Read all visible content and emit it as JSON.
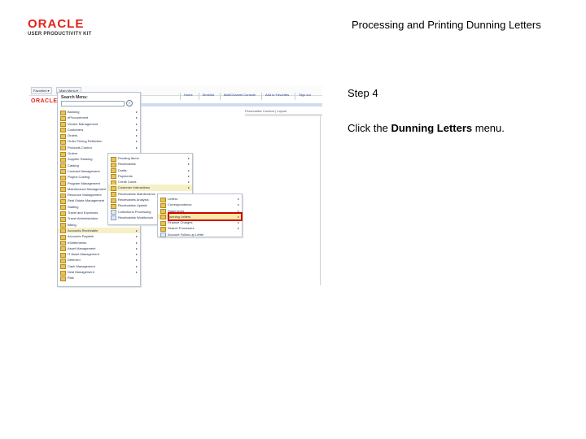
{
  "logo": {
    "word": "ORACLE",
    "sub": "USER PRODUCTIVITY KIT"
  },
  "doc": {
    "title": "Processing and Printing Dunning Letters",
    "step": "Step 4",
    "instruction_pre": "Click the ",
    "instruction_bold": "Dunning Letters",
    "instruction_post": " menu."
  },
  "screenshot": {
    "favorites": "Favorites ▾",
    "main_menu": "Main Menu ▾",
    "top_links": [
      "Home",
      "Worklist",
      "MultiChannel Console",
      "Add to Favorites",
      "Sign out"
    ],
    "mini_logo": "ORACLE",
    "personalize": "Personalize Content | Layout",
    "search_label": "Search Menu:",
    "search_go": "»",
    "menu1": [
      {
        "label": "Banking",
        "arrow": "▸"
      },
      {
        "label": "eProcurement",
        "arrow": "▸"
      },
      {
        "label": "Vendor Management",
        "arrow": "▸"
      },
      {
        "label": "Customers",
        "arrow": "▸"
      },
      {
        "label": "Orders",
        "arrow": "▸"
      },
      {
        "label": "Order Pricing Reflection",
        "arrow": "▸"
      },
      {
        "label": "Products Control",
        "arrow": "▸"
      },
      {
        "label": "Orders",
        "arrow": "▸"
      },
      {
        "label": "Supplier Ranking",
        "arrow": "▸"
      },
      {
        "label": "Catalog",
        "arrow": "▸"
      },
      {
        "label": "Contract Management",
        "arrow": "▸"
      },
      {
        "label": "Project Costing",
        "arrow": "▸"
      },
      {
        "label": "Program Management",
        "arrow": "▸"
      },
      {
        "label": "Maintenance Management",
        "arrow": "▸"
      },
      {
        "label": "Resource Management",
        "arrow": "▸"
      },
      {
        "label": "Real Estate Management",
        "arrow": "▸"
      },
      {
        "label": "Staffing",
        "arrow": "▸"
      },
      {
        "label": "Travel and Expenses",
        "arrow": "▸"
      },
      {
        "label": "Travel Administration",
        "arrow": "▸"
      },
      {
        "label": "Billing",
        "arrow": "▸"
      },
      {
        "label": "Accounts Receivable",
        "arrow": "▸"
      },
      {
        "label": "Accounts Payable",
        "arrow": "▸"
      },
      {
        "label": "eSettlements",
        "arrow": "▸"
      },
      {
        "label": "Asset Management",
        "arrow": "▸"
      },
      {
        "label": "IT Asset Management",
        "arrow": "▸"
      },
      {
        "label": "Deferred",
        "arrow": "▸"
      },
      {
        "label": "Cash Management",
        "arrow": "▸"
      },
      {
        "label": "Deal Management",
        "arrow": "▸"
      },
      {
        "label": "Risk",
        "arrow": ""
      }
    ],
    "menu2": [
      {
        "label": "Pending Items",
        "arrow": "▸"
      },
      {
        "label": "Receivables",
        "arrow": "▸"
      },
      {
        "label": "Drafts",
        "arrow": "▸"
      },
      {
        "label": "Payments",
        "arrow": "▸"
      },
      {
        "label": "Credit Cards",
        "arrow": "▸"
      },
      {
        "label": "Customer Interactions",
        "arrow": "▸"
      },
      {
        "label": "Receivables Maintenance",
        "arrow": "▸"
      },
      {
        "label": "Receivables Analysis",
        "arrow": "▸"
      },
      {
        "label": "Receivables Update",
        "arrow": "▸"
      },
      {
        "label": "Collections Processing",
        "arrow": ""
      },
      {
        "label": "Receivables Workbench",
        "arrow": ""
      }
    ],
    "menu3": [
      {
        "label": "Letters",
        "arrow": "▸"
      },
      {
        "label": "Correspondence",
        "arrow": "▸"
      },
      {
        "label": "Statements",
        "arrow": "▸"
      },
      {
        "label": "Dunning Letters",
        "arrow": "▸"
      },
      {
        "label": "Finance Charges",
        "arrow": "▸"
      },
      {
        "label": "Search Processes",
        "arrow": "▸"
      },
      {
        "label": "Account Follow-up Letter",
        "arrow": ""
      }
    ]
  }
}
